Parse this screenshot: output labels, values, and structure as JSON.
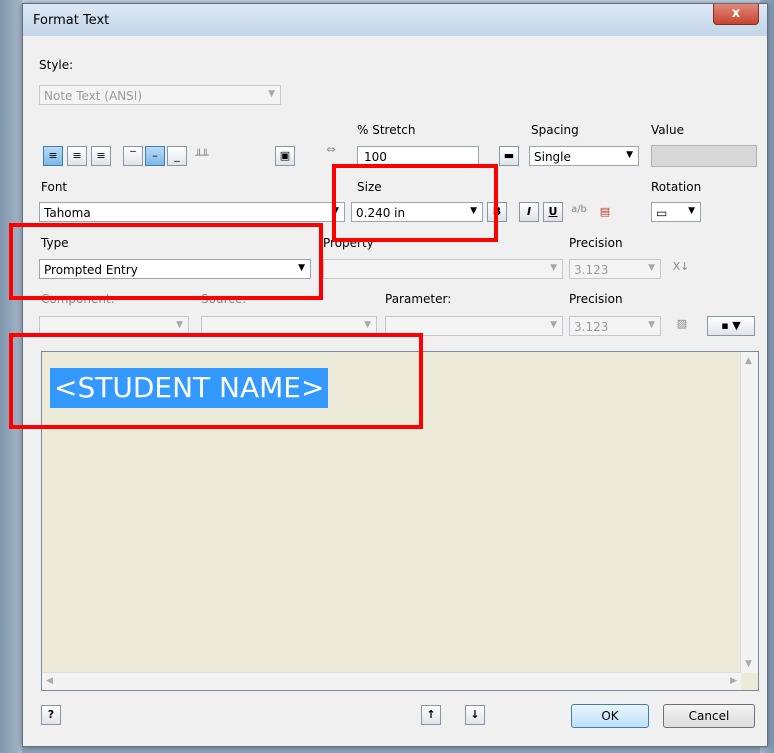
{
  "window": {
    "title": "Format Text",
    "close_label": "x"
  },
  "style": {
    "label": "Style:",
    "value": "Note Text (ANSI)"
  },
  "stretch": {
    "label": "% Stretch",
    "value": "100"
  },
  "spacing": {
    "label": "Spacing",
    "value": "Single"
  },
  "value": {
    "label": "Value"
  },
  "font": {
    "label": "Font",
    "value": "Tahoma"
  },
  "size": {
    "label": "Size",
    "value": "0.240 in"
  },
  "rotation": {
    "label": "Rotation"
  },
  "type": {
    "label": "Type",
    "value": "Prompted Entry"
  },
  "property": {
    "label": "Property"
  },
  "precision1": {
    "label": "Precision",
    "value": "3.123"
  },
  "component": {
    "label": "Component:"
  },
  "source": {
    "label": "Source:"
  },
  "parameter": {
    "label": "Parameter:"
  },
  "precision2": {
    "label": "Precision",
    "value": "3.123"
  },
  "editor": {
    "text": "<STUDENT NAME>"
  },
  "buttons": {
    "ok": "OK",
    "cancel": "Cancel"
  },
  "format_buttons": {
    "bold": "B",
    "italic": "I",
    "underline": "U"
  },
  "colors": {
    "highlight": "#3399ff",
    "editor_bg": "#ecebd9",
    "annotation": "#ff0000"
  }
}
